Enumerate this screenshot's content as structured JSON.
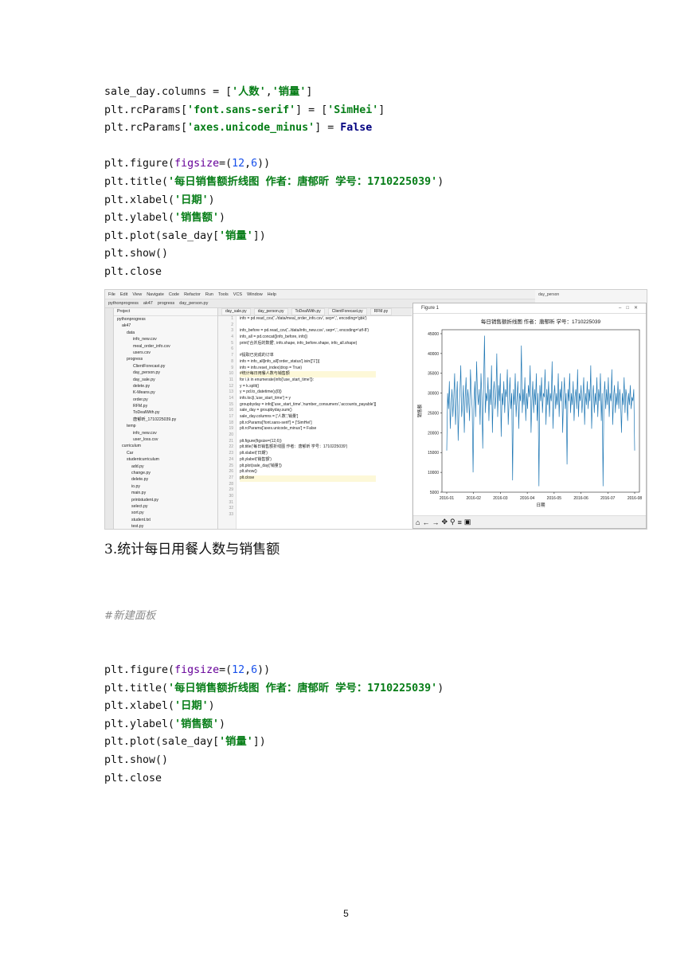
{
  "code_block_1": {
    "lines": [
      [
        {
          "t": "sale_day.columns = ["
        },
        {
          "t": "'人数'",
          "c": "s"
        },
        {
          "t": ","
        },
        {
          "t": "'销量'",
          "c": "s"
        },
        {
          "t": "]"
        }
      ],
      [
        {
          "t": "plt.rcParams["
        },
        {
          "t": "'font.sans-serif'",
          "c": "s"
        },
        {
          "t": "] = ["
        },
        {
          "t": "'SimHei'",
          "c": "s"
        },
        {
          "t": "]"
        }
      ],
      [
        {
          "t": "plt.rcParams["
        },
        {
          "t": "'axes.unicode_minus'",
          "c": "s"
        },
        {
          "t": "] = "
        },
        {
          "t": "False",
          "c": "kw"
        }
      ],
      [],
      [
        {
          "t": "plt.figure("
        },
        {
          "t": "figsize",
          "c": "kv"
        },
        {
          "t": "=("
        },
        {
          "t": "12",
          "c": "num"
        },
        {
          "t": ","
        },
        {
          "t": "6",
          "c": "num"
        },
        {
          "t": "))"
        }
      ],
      [
        {
          "t": "plt.title("
        },
        {
          "t": "'每日销售额折线图 作者：唐郁昕 学号：1710225039'",
          "c": "s"
        },
        {
          "t": ")"
        }
      ],
      [
        {
          "t": "plt.xlabel("
        },
        {
          "t": "'日期'",
          "c": "s"
        },
        {
          "t": ")"
        }
      ],
      [
        {
          "t": "plt.ylabel("
        },
        {
          "t": "'销售额'",
          "c": "s"
        },
        {
          "t": ")"
        }
      ],
      [
        {
          "t": "plt.plot(sale_day["
        },
        {
          "t": "'销量'",
          "c": "s"
        },
        {
          "t": "])"
        }
      ],
      [
        {
          "t": "plt.show()"
        }
      ],
      [
        {
          "t": "plt.close"
        }
      ]
    ]
  },
  "screenshot": {
    "menu": [
      "File",
      "Edit",
      "View",
      "Navigate",
      "Code",
      "Refactor",
      "Run",
      "Tools",
      "VCS",
      "Window",
      "Help"
    ],
    "breadcrumbs": [
      "pythonprogress",
      "ak47",
      "progress",
      "day_person.py"
    ],
    "project_label": "Project",
    "tree": [
      "pythonprogress",
      "ak47",
      "data",
      "info_new.csv",
      "meal_order_info.csv",
      "users.csv",
      "progress",
      "ClientForecast.py",
      "day_person.py",
      "day_sale.py",
      "delete.py",
      "K-Means.py",
      "order.py",
      "RFM.py",
      "ToDealWith.py",
      "唐郁昕_1710225039.py",
      "temp",
      "info_new.csv",
      "user_loss.csv",
      "curriculum",
      "Car",
      "studentcurriculum",
      "add.py",
      "change.py",
      "delete.py",
      "io.py",
      "main.py",
      "printstudent.py",
      "select.py",
      "sort.py",
      "student.txt",
      "test.py"
    ],
    "editor_tabs": [
      "day_sale.py",
      "day_person.py",
      "ToDealWith.py",
      "ClientForecast.py",
      "RFM.py"
    ],
    "line_numbers": [
      "1",
      "2",
      "3",
      "4",
      "5",
      "6",
      "7",
      "8",
      "9",
      "10",
      "11",
      "12",
      "13",
      "14",
      "15",
      "16",
      "17",
      "18",
      "19",
      "20",
      "21",
      "22",
      "23",
      "24",
      "25",
      "26",
      "27",
      "28",
      "29",
      "30",
      "31",
      "32",
      "33"
    ],
    "editor_lines": [
      "info = pd.read_csv('../data/meal_order_info.csv', sep=',', encoding='gbk')",
      "",
      "info_before = pd.read_csv('../data/info_new.csv', sep=',', encoding='utf-8')",
      "info_all = pd.concat([info_before, info])",
      "print('合并后的数据', info.shape, info_before.shape, info_all.shape)",
      "",
      "#提取已完成的订单",
      "info = info_all[info_all['order_status'].isin(['1'])]",
      "info = info.reset_index(drop = True)",
      "#统计每日用餐人数与销售额",
      "for i,k in enumerate(info['use_start_time']):",
      "    y = k.split()",
      "    y = pd.to_datetime(y[0])",
      "    info.loc[i,'use_start_time'] = y",
      "groupbyday = info[['use_start_time','number_consumers','accounts_payable']]",
      "sale_day = groupbyday.sum()",
      "sale_day.columns = ['人数','销量']",
      "plt.rcParams['font.sans-serif'] = ['SimHei']",
      "plt.rcParams['axes.unicode_minus'] = False",
      "",
      "plt.figure(figsize=(12,6))",
      "plt.title('每日销售额折线图 作者：唐郁昕 学号：1710225039')",
      "plt.xlabel('日期')",
      "plt.ylabel('销售额')",
      "plt.plot(sale_day['销量'])",
      "plt.show()",
      "plt.close"
    ],
    "figure_window_title": "Figure 1",
    "right_panel_label": "day_person"
  },
  "chart_data": {
    "type": "line",
    "title": "每日销售额折线图 作者：唐郁昕 学号：1710225039",
    "xlabel": "日期",
    "ylabel": "销售额",
    "x_ticks": [
      "2016-01",
      "2016-02",
      "2016-03",
      "2016-04",
      "2016-05",
      "2016-06",
      "2016-07",
      "2016-08"
    ],
    "y_ticks": [
      5000,
      10000,
      15000,
      20000,
      25000,
      30000,
      35000,
      40000,
      45000
    ],
    "ylim": [
      5000,
      46000
    ],
    "line_color": "#1f77b4",
    "series": [
      {
        "values": [
          15500,
          30000,
          26000,
          33000,
          21000,
          27000,
          31000,
          24000,
          29000,
          35000,
          22000,
          28000,
          33000,
          18000,
          26000,
          30000,
          37000,
          24000,
          27000,
          32000,
          20000,
          29000,
          34000,
          25000,
          31000,
          28000,
          23000,
          36000,
          30000,
          26000,
          10000,
          28000,
          33000,
          24000,
          38000,
          30000,
          27000,
          31000,
          22000,
          35000,
          29000,
          16000,
          32000,
          44500,
          25000,
          30000,
          28000,
          34000,
          23000,
          31000,
          27000,
          37000,
          20000,
          30000,
          33000,
          26000,
          29000,
          40000,
          24000,
          32000,
          28000,
          35000,
          19000,
          30000,
          27000,
          33000,
          25000,
          31000,
          29000,
          36000,
          22000,
          28000,
          34000,
          26000,
          30000,
          8000,
          31000,
          27000,
          35000,
          24000,
          29000,
          33000,
          21000,
          30000,
          28000,
          42000,
          25000,
          31000,
          27000,
          34000,
          23000,
          30000,
          26000,
          32000,
          29000,
          37000,
          20000,
          28000,
          33000,
          25000,
          31000,
          27000,
          35000,
          23000,
          30000,
          6500,
          32000,
          28000,
          34000,
          25000,
          30000,
          29000,
          36000,
          22000,
          31000,
          27000,
          33000,
          24000,
          30000,
          28000,
          38000,
          21000,
          29000,
          32000,
          26000,
          30000,
          27000,
          35000,
          24000,
          31000,
          28000,
          33000,
          20000,
          29000,
          34000,
          26000,
          30000,
          12000,
          31000,
          28000,
          35000,
          25000,
          30000,
          27000,
          33000,
          23000,
          29000,
          31000,
          26000,
          36000,
          24000,
          30000,
          28000,
          32000,
          25000,
          29000,
          34000,
          22000,
          30000,
          27000,
          33000,
          26000,
          31000,
          28000,
          37000,
          21000,
          29000,
          32000,
          25000,
          30000,
          27000,
          34000,
          24000,
          31000,
          28000,
          35000,
          23000,
          30000,
          6500,
          29000,
          33000,
          26000,
          31000,
          27000,
          34000,
          24000,
          30000,
          28000,
          36000,
          22000,
          29000,
          32000,
          25000,
          30000,
          27000,
          33000,
          26000,
          31000,
          28000,
          20000,
          30000,
          27000,
          34000,
          25000,
          31000,
          29000,
          23000,
          30000,
          27000,
          32000,
          26000,
          29000,
          28000,
          31000,
          15500
        ]
      }
    ]
  },
  "heading": "3.统计每日用餐人数与销售额",
  "code_block_2": {
    "comment": "#新建面板",
    "lines": [
      [
        {
          "t": "plt.figure("
        },
        {
          "t": "figsize",
          "c": "kv"
        },
        {
          "t": "=("
        },
        {
          "t": "12",
          "c": "num"
        },
        {
          "t": ","
        },
        {
          "t": "6",
          "c": "num"
        },
        {
          "t": "))"
        }
      ],
      [
        {
          "t": "plt.title("
        },
        {
          "t": "'每日销售额折线图 作者：唐郁昕 学号：1710225039'",
          "c": "s"
        },
        {
          "t": ")"
        }
      ],
      [
        {
          "t": "plt.xlabel("
        },
        {
          "t": "'日期'",
          "c": "s"
        },
        {
          "t": ")"
        }
      ],
      [
        {
          "t": "plt.ylabel("
        },
        {
          "t": "'销售额'",
          "c": "s"
        },
        {
          "t": ")"
        }
      ],
      [
        {
          "t": "plt.plot(sale_day["
        },
        {
          "t": "'销量'",
          "c": "s"
        },
        {
          "t": "])"
        }
      ],
      [
        {
          "t": "plt.show()"
        }
      ],
      [
        {
          "t": "plt.close"
        }
      ]
    ]
  },
  "page_number": "5"
}
